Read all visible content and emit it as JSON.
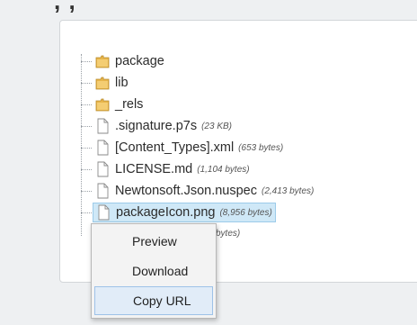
{
  "tree": {
    "items": [
      {
        "type": "folder",
        "name": "package",
        "size": ""
      },
      {
        "type": "folder",
        "name": "lib",
        "size": ""
      },
      {
        "type": "folder",
        "name": "_rels",
        "size": ""
      },
      {
        "type": "file",
        "name": ".signature.p7s",
        "size": "(23 KB)"
      },
      {
        "type": "file",
        "name": "[Content_Types].xml",
        "size": "(653 bytes)"
      },
      {
        "type": "file",
        "name": "LICENSE.md",
        "size": "(1,104 bytes)"
      },
      {
        "type": "file",
        "name": "Newtonsoft.Json.nuspec",
        "size": "(2,413 bytes)"
      },
      {
        "type": "file",
        "name": "packageIcon.png",
        "size": "(8,956 bytes)",
        "selected": true
      }
    ],
    "partial_row_size": "bytes)"
  },
  "context_menu": {
    "items": [
      "Preview",
      "Download",
      "Copy URL"
    ],
    "hovered": "Copy URL"
  },
  "colors": {
    "folder": "#e8b64c",
    "selection_bg": "#cfe8f7",
    "menu_hover_bg": "#e1ecf8"
  }
}
